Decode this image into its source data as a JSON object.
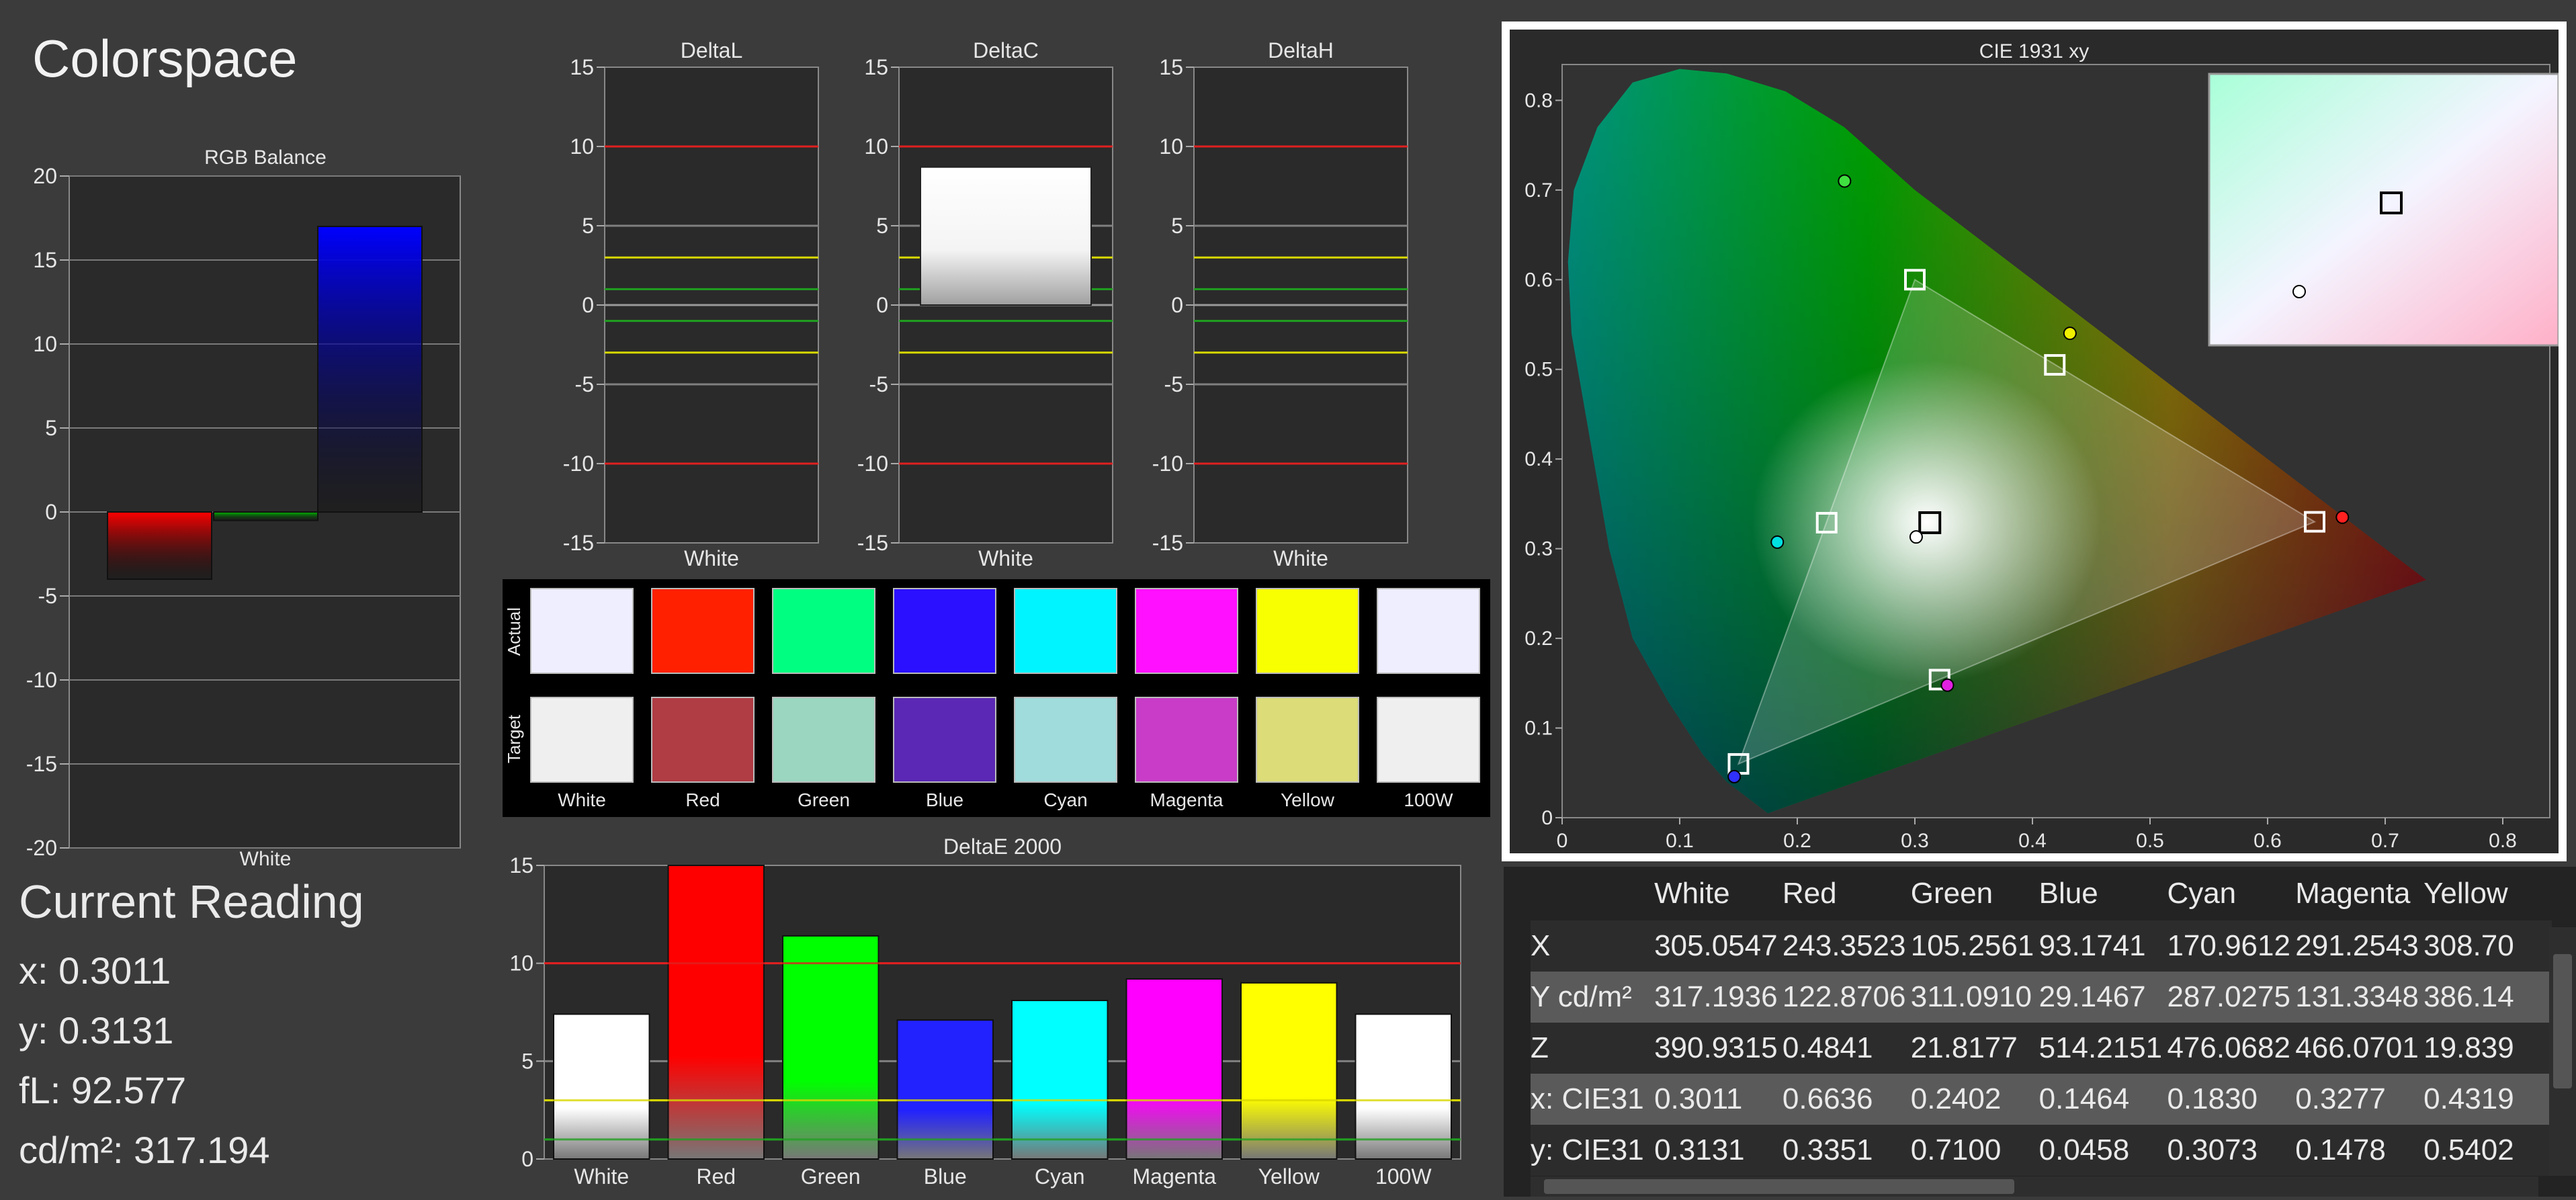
{
  "app_title": "Colorspace",
  "rgb_balance": {
    "title": "RGB Balance",
    "category": "White",
    "y_ticks": [
      "20",
      "15",
      "10",
      "5",
      "0",
      "-5",
      "-10",
      "-15",
      "-20"
    ],
    "values": {
      "red": -4,
      "green": -0.5,
      "blue": 17
    },
    "colors": {
      "red": "#ff0000",
      "green": "#00c000",
      "blue": "#0000ff"
    }
  },
  "delta_charts": [
    {
      "title": "DeltaL",
      "category": "White",
      "value": 0
    },
    {
      "title": "DeltaC",
      "category": "White",
      "value": 8.7
    },
    {
      "title": "DeltaH",
      "category": "White",
      "value": 0
    }
  ],
  "delta_ticks": [
    "15",
    "10",
    "5",
    "0",
    "-5",
    "-10",
    "-15"
  ],
  "swatches": {
    "actual_label": "Actual",
    "target_label": "Target",
    "items": [
      {
        "name": "White",
        "actual": "#eeeeff",
        "target": "#efefef"
      },
      {
        "name": "Red",
        "actual": "#ff2000",
        "target": "#b03c44"
      },
      {
        "name": "Green",
        "actual": "#00ff80",
        "target": "#9ad6c0"
      },
      {
        "name": "Blue",
        "actual": "#2a10ff",
        "target": "#5a28b4"
      },
      {
        "name": "Cyan",
        "actual": "#00f4ff",
        "target": "#a0dcdc"
      },
      {
        "name": "Magenta",
        "actual": "#ff10ff",
        "target": "#c83cc8"
      },
      {
        "name": "Yellow",
        "actual": "#f8ff00",
        "target": "#dcdc78"
      },
      {
        "name": "100W",
        "actual": "#eeeeff",
        "target": "#efefef"
      }
    ]
  },
  "deltae": {
    "title": "DeltaE 2000",
    "y_ticks": [
      "15",
      "10",
      "5",
      "0"
    ],
    "bars": [
      {
        "name": "White",
        "value": 7.4,
        "color": "#ffffff"
      },
      {
        "name": "Red",
        "value": 15.5,
        "color": "#ff0000"
      },
      {
        "name": "Green",
        "value": 11.4,
        "color": "#00ff00"
      },
      {
        "name": "Blue",
        "value": 7.1,
        "color": "#2222ff"
      },
      {
        "name": "Cyan",
        "value": 8.1,
        "color": "#00ffff"
      },
      {
        "name": "Magenta",
        "value": 9.2,
        "color": "#ff00ff"
      },
      {
        "name": "Yellow",
        "value": 9.0,
        "color": "#ffff00"
      },
      {
        "name": "100W",
        "value": 7.4,
        "color": "#ffffff"
      }
    ]
  },
  "current_reading": {
    "heading": "Current Reading",
    "x": "x: 0.3011",
    "y": "y: 0.3131",
    "fl": "fL: 92.577",
    "cd": "cd/m²: 317.194"
  },
  "cie": {
    "title": "CIE 1931 xy",
    "x_ticks": [
      "0",
      "0.1",
      "0.2",
      "0.3",
      "0.4",
      "0.5",
      "0.6",
      "0.7",
      "0.8"
    ],
    "y_ticks": [
      "0",
      "0.1",
      "0.2",
      "0.3",
      "0.4",
      "0.5",
      "0.6",
      "0.7",
      "0.8"
    ],
    "target_points": [
      {
        "name": "Red",
        "x": 0.64,
        "y": 0.33
      },
      {
        "name": "Green",
        "x": 0.3,
        "y": 0.6
      },
      {
        "name": "Blue",
        "x": 0.15,
        "y": 0.06
      },
      {
        "name": "Cyan",
        "x": 0.225,
        "y": 0.329
      },
      {
        "name": "Magenta",
        "x": 0.321,
        "y": 0.154
      },
      {
        "name": "Yellow",
        "x": 0.419,
        "y": 0.505
      },
      {
        "name": "White",
        "x": 0.3127,
        "y": 0.329
      }
    ],
    "measured_points": [
      {
        "name": "Red",
        "x": 0.6636,
        "y": 0.3351,
        "color": "#ff2020"
      },
      {
        "name": "Green",
        "x": 0.2402,
        "y": 0.71,
        "color": "#40e040"
      },
      {
        "name": "Blue",
        "x": 0.1464,
        "y": 0.0458,
        "color": "#3030ff"
      },
      {
        "name": "Cyan",
        "x": 0.183,
        "y": 0.3073,
        "color": "#00e0e0"
      },
      {
        "name": "Magenta",
        "x": 0.3277,
        "y": 0.1478,
        "color": "#e020e0"
      },
      {
        "name": "Yellow",
        "x": 0.4319,
        "y": 0.5402,
        "color": "#f0f000"
      },
      {
        "name": "White",
        "x": 0.3011,
        "y": 0.3131,
        "color": "#ffffff"
      }
    ]
  },
  "table": {
    "columns": [
      "",
      "White",
      "Red",
      "Green",
      "Blue",
      "Cyan",
      "Magenta",
      "Yellow"
    ],
    "rows": [
      {
        "label": "X",
        "values": [
          "305.0547",
          "243.3523",
          "105.2561",
          "93.1741",
          "170.9612",
          "291.2543",
          "308.70"
        ]
      },
      {
        "label": "Y cd/m²",
        "values": [
          "317.1936",
          "122.8706",
          "311.0910",
          "29.1467",
          "287.0275",
          "131.3348",
          "386.14"
        ]
      },
      {
        "label": "Z",
        "values": [
          "390.9315",
          "0.4841",
          "21.8177",
          "514.2151",
          "476.0682",
          "466.0701",
          "19.839"
        ]
      },
      {
        "label": "x: CIE31",
        "values": [
          "0.3011",
          "0.6636",
          "0.2402",
          "0.1464",
          "0.1830",
          "0.3277",
          "0.4319"
        ]
      },
      {
        "label": "y: CIE31",
        "values": [
          "0.3131",
          "0.3351",
          "0.7100",
          "0.0458",
          "0.3073",
          "0.1478",
          "0.5402"
        ]
      }
    ]
  }
}
